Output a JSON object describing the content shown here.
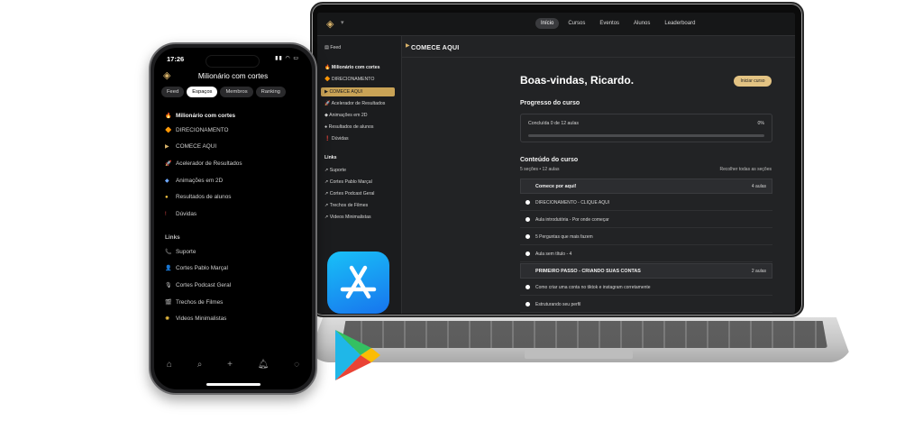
{
  "laptop": {
    "topnav": [
      "Início",
      "Cursos",
      "Eventos",
      "Alunos",
      "Leaderboard"
    ],
    "sidebar": {
      "feed": "Feed",
      "group": "Milionário com cortes",
      "items": [
        "DIRECIONAMENTO",
        "COMECE AQUI",
        "Acelerador de Resultados",
        "Animações em 2D",
        "Resultados de alunos",
        "Dúvidas"
      ],
      "links_header": "Links",
      "links": [
        "Suporte",
        "Cortes Pablo Marçal",
        "Cortes Podcast Geral",
        "Trechos de Filmes",
        "Videos Minimalistas"
      ]
    },
    "header_title": "COMECE AQUI",
    "welcome": "Boas-vindas, Ricardo.",
    "start_button": "Iniciar curso",
    "progress": {
      "title": "Progresso do curso",
      "label": "Concluída 0 de 12 aulas",
      "percent_text": "0%",
      "fraction": 0
    },
    "content": {
      "title": "Conteúdo do curso",
      "meta": "5 seções • 12 aulas",
      "collapse": "Recolher todas as seções",
      "sections": [
        {
          "name": "Comece por aqui!",
          "count": "4 aulas",
          "lessons": [
            "DIRECIONAMENTO - CLIQUE AQUI",
            "Aula introdutória - Por onde começar",
            "5 Perguntas que mais fazem",
            "Aula sem título - 4"
          ]
        },
        {
          "name": "PRIMEIRO PASSO - CRIANDO SUAS CONTAS",
          "count": "2 aulas",
          "lessons": [
            "Como criar uma conta no tiktok e instagram corretamente",
            "Estruturando seu perfil"
          ]
        }
      ]
    }
  },
  "phone": {
    "time": "17:26",
    "title": "Milionário com cortes",
    "tabs": [
      "Feed",
      "Espaços",
      "Membros",
      "Ranking"
    ],
    "active_tab": "Espaços",
    "group": "Milionário com cortes",
    "items": [
      "DIRECIONAMENTO",
      "COMECE AQUI",
      "Acelerador de Resultados",
      "Animações em 2D",
      "Resultados de alunos",
      "Dúvidas"
    ],
    "links_header": "Links",
    "links": [
      "Suporte",
      "Cortes Pablo Marçal",
      "Cortes Podcast Geral",
      "Trechos de Filmes",
      "Videos Minimalistas"
    ]
  },
  "colors": {
    "accent": "#c9a356",
    "start_button": "#e3c383",
    "app_store": "#1774ee"
  }
}
